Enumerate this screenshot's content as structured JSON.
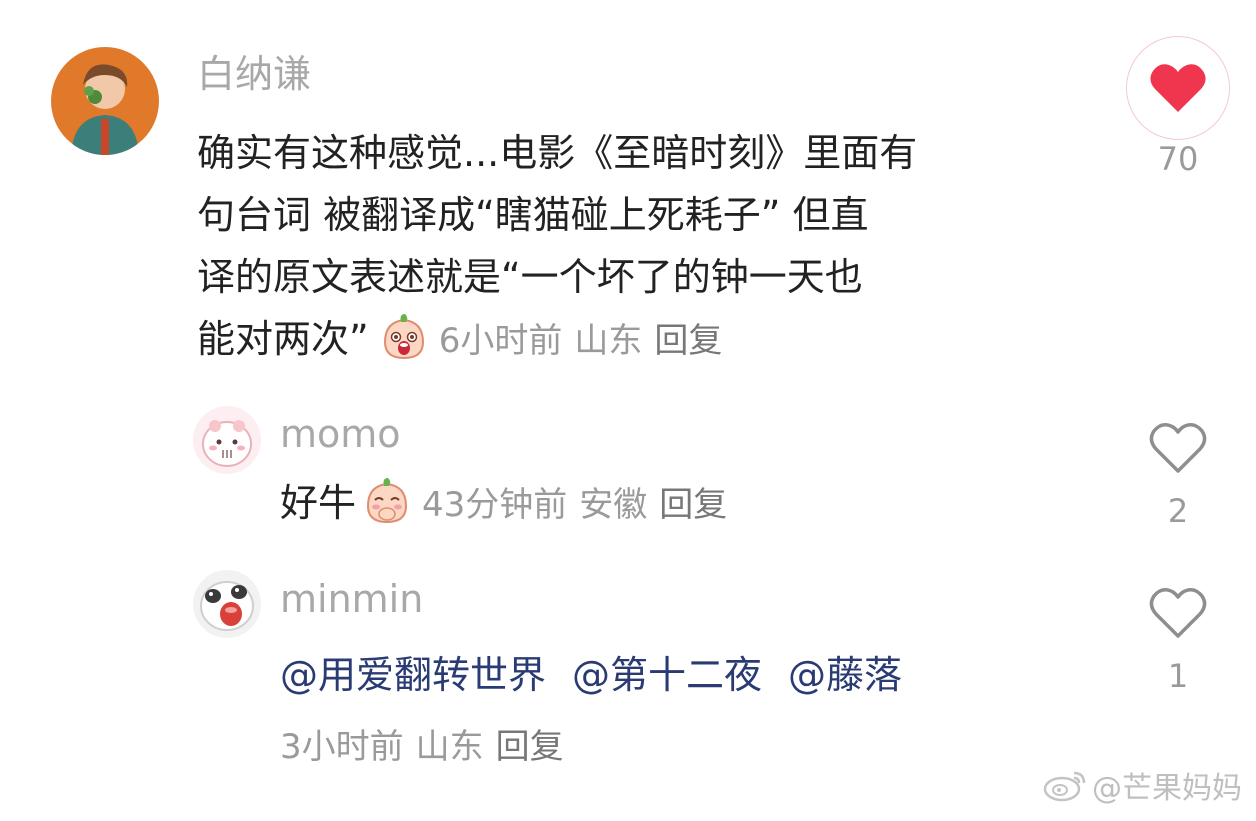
{
  "colors": {
    "like_red": "#f0354f",
    "mention_blue": "#2a3b73",
    "meta_gray": "#9a9a9a"
  },
  "main_comment": {
    "username": "白纳谦",
    "text_lines": [
      "确实有这种感觉...电影《至暗时刻》里面有",
      "句台词 被翻译成“瞎猫碰上死耗子” 但直",
      "译的原文表述就是“一个坏了的钟一天也",
      "能对两次”"
    ],
    "emoji": "laughing-peach-emoji",
    "time": "6小时前",
    "location": "山东",
    "reply_label": "回复",
    "likes": "70",
    "liked": true
  },
  "replies": [
    {
      "username": "momo",
      "text": "好牛",
      "emoji": "shy-peach-emoji",
      "time": "43分钟前",
      "location": "安徽",
      "reply_label": "回复",
      "likes": "2",
      "liked": false
    },
    {
      "username": "minmin",
      "mentions": [
        "@用爱翻转世界",
        "@第十二夜",
        "@藤落"
      ],
      "time": "3小时前",
      "location": "山东",
      "reply_label": "回复",
      "likes": "1",
      "liked": false
    }
  ],
  "watermark": {
    "icon": "weibo-icon",
    "text": "@芒果妈妈"
  }
}
